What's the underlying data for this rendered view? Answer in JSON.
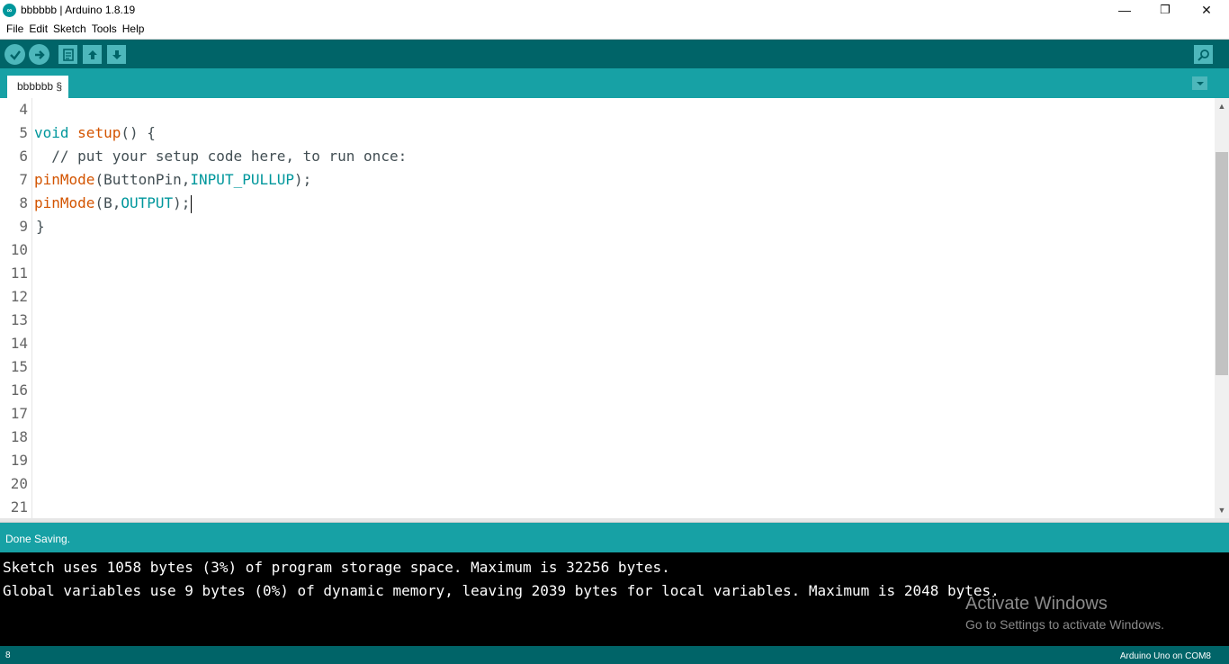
{
  "window": {
    "title": "bbbbbb | Arduino 1.8.19",
    "app_icon_text": "∞",
    "minimize": "—",
    "restore": "❐",
    "close": "✕"
  },
  "menu": [
    "File",
    "Edit",
    "Sketch",
    "Tools",
    "Help"
  ],
  "toolbar": {
    "buttons": [
      "verify-icon",
      "upload-icon",
      "new-icon",
      "open-icon",
      "save-icon"
    ],
    "right": "serial-monitor-icon"
  },
  "tabs": {
    "active": "bbbbbb §"
  },
  "editor": {
    "line_numbers": [
      "4",
      "5",
      "6",
      "7",
      "8",
      "9",
      "10",
      "11",
      "12",
      "13",
      "14",
      "15",
      "16",
      "17",
      "18",
      "19",
      "20",
      "21"
    ],
    "code": {
      "l5_kw": "void",
      "l5_fn": "setup",
      "l5_rest": "() {",
      "l6": "  // put your setup code here, to run once:",
      "l7_fn": "pinMode",
      "l7_mid": "(ButtonPin,",
      "l7_const": "INPUT_PULLUP",
      "l7_end": ");",
      "l8_fn": "pinMode",
      "l8_mid": "(B,",
      "l8_const": "OUTPUT",
      "l8_end": ");",
      "l9": "}"
    }
  },
  "status": {
    "message": "Done Saving."
  },
  "console": {
    "lines": [
      "Sketch uses 1058 bytes (3%) of program storage space. Maximum is 32256 bytes.",
      "Global variables use 9 bytes (0%) of dynamic memory, leaving 2039 bytes for local variables. Maximum is 2048 bytes."
    ],
    "watermark_title": "Activate Windows",
    "watermark_sub": "Go to Settings to activate Windows."
  },
  "footer": {
    "line": "8",
    "board": "Arduino Uno on COM8"
  },
  "colors": {
    "toolbar": "#006468",
    "tabbar": "#17a1a5",
    "keyword": "#00979c",
    "function": "#d35400"
  }
}
